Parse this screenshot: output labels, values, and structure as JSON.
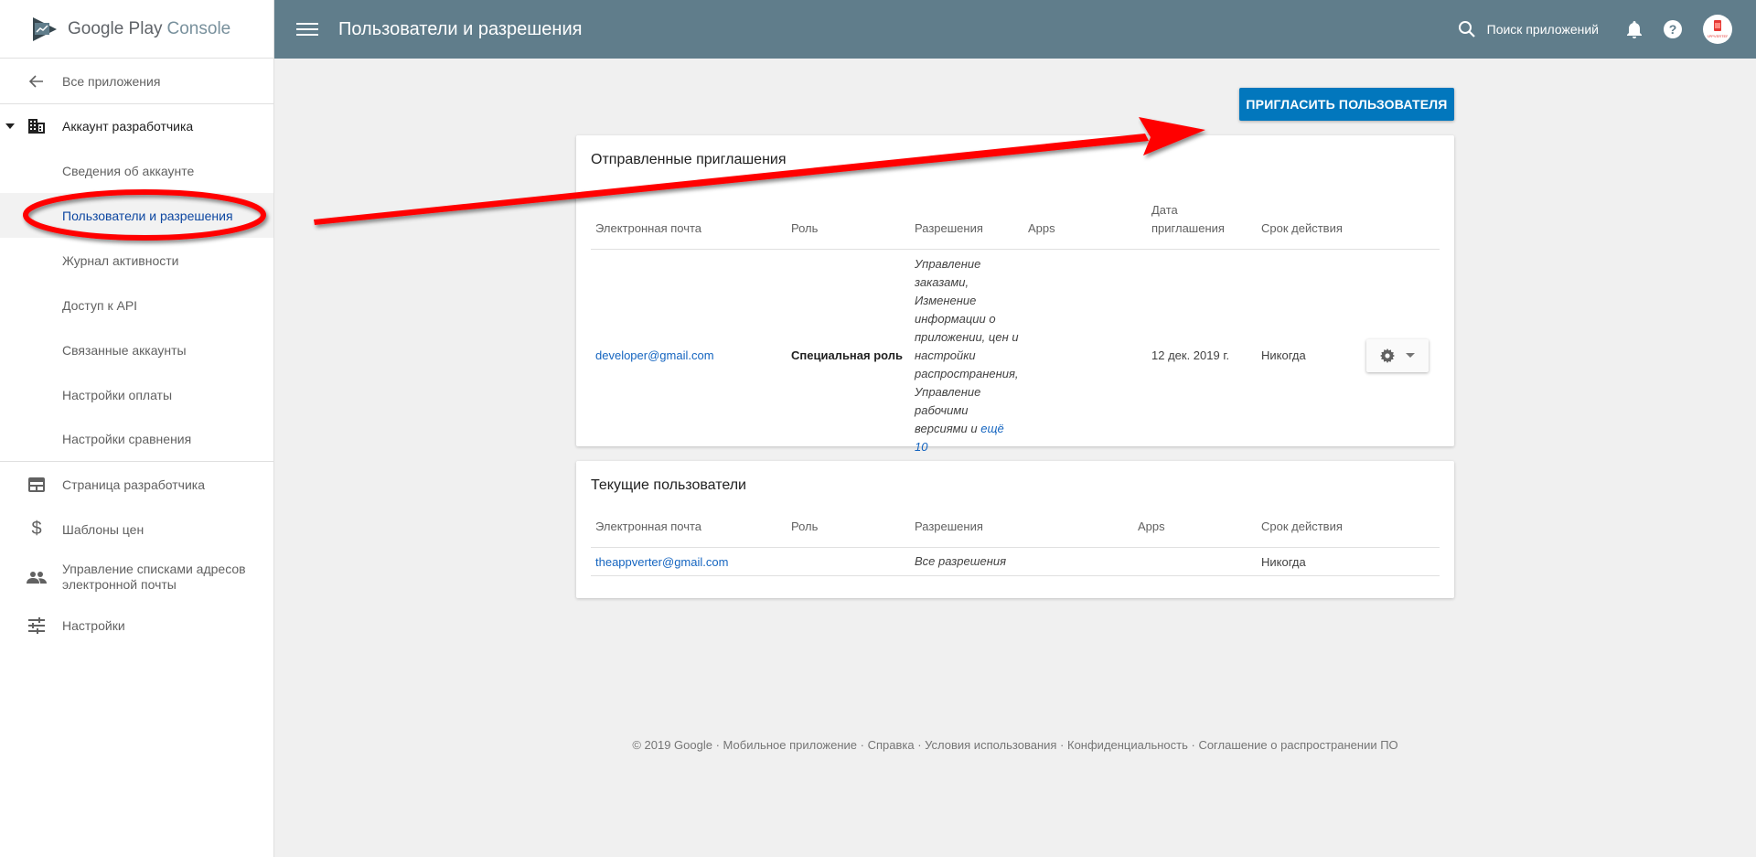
{
  "app": {
    "logo_google_play": "Google Play",
    "logo_console": "Console"
  },
  "sidebar": {
    "back": {
      "label": "Все приложения",
      "icon": "arrow-left-icon"
    },
    "section": {
      "label": "Аккаунт разработчика",
      "icon": "building-icon"
    },
    "sub_items": [
      {
        "label": "Сведения об аккаунте",
        "active": false
      },
      {
        "label": "Пользователи и разрешения",
        "active": true
      },
      {
        "label": "Журнал активности",
        "active": false
      },
      {
        "label": "Доступ к API",
        "active": false
      },
      {
        "label": "Связанные аккаунты",
        "active": false
      },
      {
        "label": "Настройки оплаты",
        "active": false
      },
      {
        "label": "Настройки сравнения",
        "active": false
      }
    ],
    "items": [
      {
        "label": "Страница разработчика",
        "icon": "web-page-icon"
      },
      {
        "label": "Шаблоны цен",
        "icon": "dollar-icon"
      },
      {
        "label": "Управление списками адресов электронной почты",
        "icon": "people-icon"
      },
      {
        "label": "Настройки",
        "icon": "sliders-icon"
      }
    ]
  },
  "header": {
    "title": "Пользователи и разрешения",
    "search_label": "Поиск приложений",
    "avatar_text": "APPVERTER"
  },
  "main": {
    "invite_button": "ПРИГЛАСИТЬ ПОЛЬЗОВАТЕЛЯ",
    "sent": {
      "title": "Отправленные приглашения",
      "columns": [
        "Электронная почта",
        "Роль",
        "Разрешения",
        "Apps",
        "Дата приглашения",
        "Срок действия"
      ],
      "rows": [
        {
          "email": "developer@gmail.com",
          "role": "Специальная роль",
          "permissions": "Управление заказами, Изменение информации о приложении, цен и настройки распространения, Управление рабочими версиями и",
          "permissions_more": "ещё 10",
          "apps": "",
          "date": "12 дек. 2019 г.",
          "expires": "Никогда"
        }
      ]
    },
    "current": {
      "title": "Текущие пользователи",
      "columns": [
        "Электронная почта",
        "Роль",
        "Разрешения",
        "Apps",
        "Срок действия"
      ],
      "rows": [
        {
          "email": "theappverter@gmail.com",
          "role": "",
          "permissions": "Все разрешения",
          "apps": "",
          "expires": "Никогда"
        }
      ]
    }
  },
  "footer": {
    "items": [
      "© 2019 Google",
      "Мобильное приложение",
      "Справка",
      "Условия использования",
      "Конфиденциальность",
      "Соглашение о распространении ПО"
    ],
    "separator": " · "
  },
  "annotation": {
    "color": "#ff0000"
  }
}
